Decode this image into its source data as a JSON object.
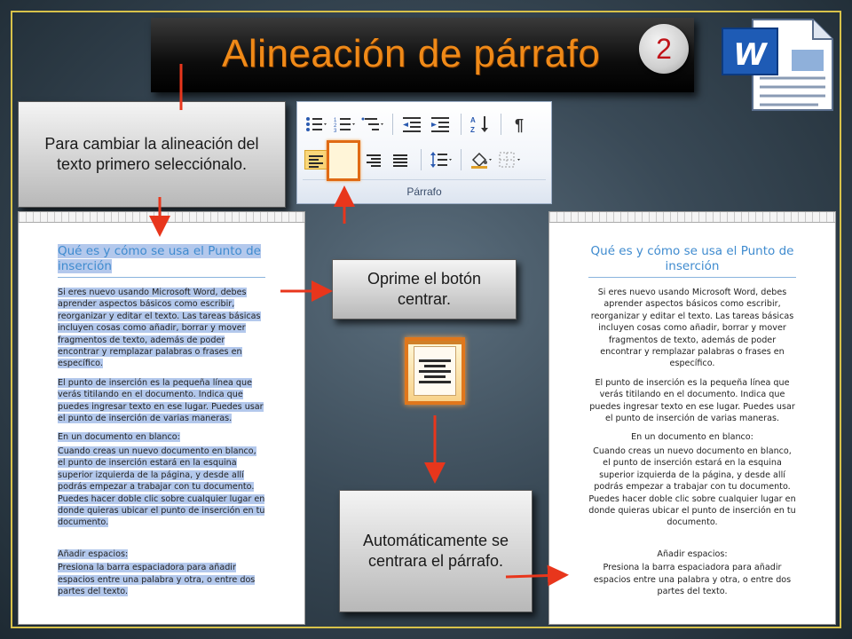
{
  "title": "Alineación de párrafo",
  "step_number": "2",
  "callouts": {
    "select": "Para cambiar la alineación del texto primero selecciónalo.",
    "press": "Oprime el botón centrar.",
    "result": "Automáticamente se centrara el párrafo."
  },
  "ribbon": {
    "group_label": "Párrafo",
    "icons": [
      "bullets-icon",
      "numbering-icon",
      "multilevel-list-icon",
      "decrease-indent-icon",
      "increase-indent-icon",
      "sort-icon",
      "show-marks-icon",
      "align-left-icon",
      "align-center-icon",
      "align-right-icon",
      "justify-icon",
      "line-spacing-icon",
      "shading-icon",
      "borders-icon"
    ],
    "active_button": "align-center-icon"
  },
  "document": {
    "heading": "Qué es y cómo se usa el Punto de inserción",
    "paragraphs": [
      "Si eres nuevo usando Microsoft Word, debes aprender aspectos básicos como escribir, reorganizar y editar el texto. Las tareas básicas incluyen cosas como añadir, borrar y mover fragmentos de texto, además de poder encontrar y remplazar palabras o frases en específico.",
      "El punto de inserción es la pequeña línea que verás titilando en el documento. Indica que puedes ingresar texto en ese lugar. Puedes usar el punto de inserción de varias maneras."
    ],
    "subheading1": "En un documento en blanco:",
    "paragraph3": "Cuando creas un nuevo documento en blanco, el punto de inserción estará en la esquina superior izquierda de la página, y desde allí podrás empezar a trabajar con tu documento. Puedes hacer doble clic sobre cualquier lugar en donde quieras ubicar el punto de inserción en tu documento.",
    "subheading2": "Añadir espacios:",
    "paragraph4": "Presiona la barra espaciadora para añadir espacios entre una palabra y otra, o entre dos partes del texto."
  },
  "colors": {
    "title": "#f08a18",
    "badge_number": "#c0141a",
    "arrow": "#e8361c",
    "selection": "#b3c8ec",
    "heading": "#3f8bcf",
    "frame": "#d8c24a"
  }
}
